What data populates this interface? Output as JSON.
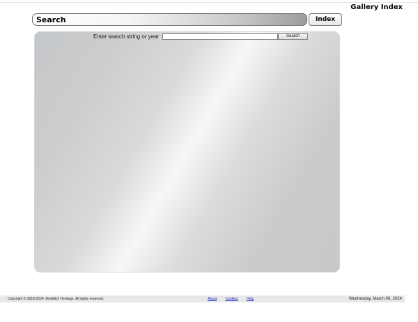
{
  "header": {
    "gallery_index_label": "Gallery Index",
    "title": "Search",
    "index_button_label": "Index"
  },
  "search": {
    "prompt_label": "Enter search string or year",
    "input_value": "",
    "button_label": "Search"
  },
  "footer": {
    "copyright": "Copyright © 2018-2024, Redditch Heritage. All rights reserved.",
    "links": {
      "about": "About",
      "cookies": "Cookies",
      "help": "Help"
    },
    "date": "Wednesday, March 06, 2024"
  },
  "colors": {
    "link": "#1a24c8",
    "footer_background": "#e8e8e8",
    "panel_gradient_dark": "#c4c7ca",
    "panel_gradient_light": "#f7f7f7"
  }
}
